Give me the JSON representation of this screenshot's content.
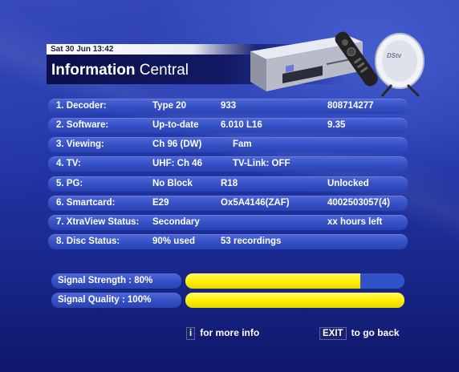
{
  "status": {
    "datetime": "Sat 30 Jun 13:42"
  },
  "header": {
    "title_bold": "Information",
    "title_rest": " Central"
  },
  "rows": [
    {
      "c1": "1. Decoder:",
      "c2": "Type 20",
      "c3": "933",
      "c4": "808714277"
    },
    {
      "c1": "2. Software:",
      "c2": "Up-to-date",
      "c3": "6.010  L16",
      "c4": "9.35"
    },
    {
      "c1": "3. Viewing:",
      "c2": "Ch 96 (DW)",
      "c3": "Fam",
      "c4": ""
    },
    {
      "c1": "4. TV:",
      "c2": "UHF: Ch 46",
      "c3": "TV-Link: OFF",
      "c4": ""
    },
    {
      "c1": "5. PG:",
      "c2": "No Block",
      "c3": "R18",
      "c4": "Unlocked"
    },
    {
      "c1": "6. Smartcard:",
      "c2": "E29",
      "c3": "Ox5A4146(ZAF)",
      "c4": "4002503057(4)"
    },
    {
      "c1": "7. XtraView Status:",
      "c2": "Secondary",
      "c3": "",
      "c4": "xx hours left"
    },
    {
      "c1": "8. Disc Status:",
      "c2": "90% used",
      "c3": "53 recordings",
      "c4": ""
    }
  ],
  "signal": {
    "strength_label": "Signal Strength  :  80%",
    "strength_percent": 80,
    "quality_label": "Signal Quality    : 100%",
    "quality_percent": 100
  },
  "footer": {
    "info_key": "i",
    "info_text": "for more info",
    "exit_key": "EXIT",
    "exit_text": "to go back"
  },
  "device": {
    "dish_logo": "DStv"
  },
  "colors": {
    "bar_fill": "#fff000",
    "row_bg": "#3a55c8",
    "header_bg": "#0b0f4a"
  }
}
